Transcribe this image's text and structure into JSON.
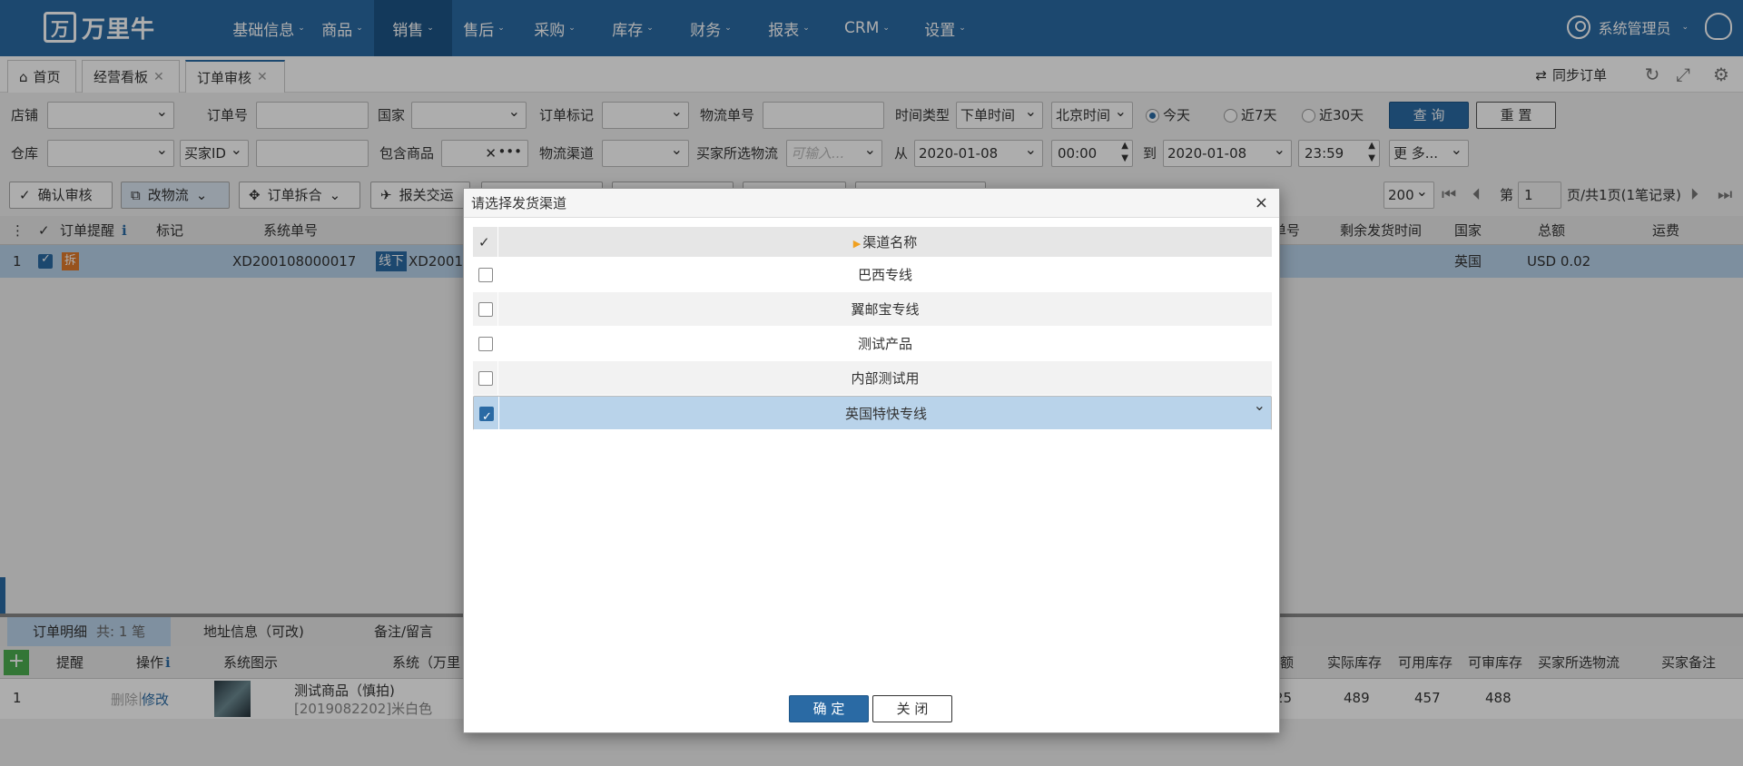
{
  "nav": {
    "logo_mark": "万",
    "logo_text": "万里牛",
    "menu": [
      "基础信息",
      "商品",
      "销售",
      "售后",
      "采购",
      "库存",
      "财务",
      "报表",
      "CRM",
      "设置"
    ],
    "active_index": 2,
    "user": "系统管理员"
  },
  "tabs": {
    "home": "首页",
    "t1": "经营看板",
    "t2": "订单审核",
    "sync": "同步订单"
  },
  "filters": {
    "shop": "店铺",
    "order_no": "订单号",
    "country": "国家",
    "order_mark": "订单标记",
    "logistics_no": "物流单号",
    "time_type": "时间类型",
    "time_type_val": "下单时间",
    "tz_val": "北京时间",
    "today": "今天",
    "d7": "近7天",
    "d30": "近30天",
    "query": "查 询",
    "reset": "重 置",
    "warehouse": "仓库",
    "buyer_id": "买家ID",
    "contains": "包含商品",
    "channel": "物流渠道",
    "buyer_logistics": "买家所选物流",
    "buyer_logistics_ph": "可输入...",
    "from": "从",
    "date_from": "2020-01-08",
    "time_from": "00:00",
    "to": "到",
    "date_to": "2020-01-08",
    "time_to": "23:59",
    "more": "更 多..."
  },
  "toolbar": {
    "confirm": "确认审核",
    "change": "改物流",
    "split": "订单拆合",
    "report": "报关交运",
    "page_size": "200",
    "page_label": "第",
    "page_num": "1",
    "page_info": "页/共1页(1笔记录)"
  },
  "grid": {
    "headers": {
      "remind": "订单提醒",
      "mark": "标记",
      "sys_no": "系统单号",
      "country": "国家",
      "total": "总额",
      "freight": "运费",
      "remaining": "剩余发货时间",
      "h_extra": "单号"
    },
    "row": {
      "idx": "1",
      "badge": "拆",
      "sys_no": "XD200108000017",
      "tag": "线下",
      "sys_no2": "XD2001",
      "country": "英国",
      "total": "USD 0.02"
    }
  },
  "lower": {
    "tabs": [
      "订单明细",
      "地址信息（可改)",
      "备注/留言"
    ],
    "count": "共: 1 笔",
    "headers": {
      "remind": "提醒",
      "op": "操作",
      "img": "系统图示",
      "sys": "系统（万里",
      "amt": "额",
      "real": "实际库存",
      "avail": "可用库存",
      "ok": "可审库存",
      "buyer_log": "买家所选物流",
      "buyer_note": "买家备注"
    },
    "row": {
      "idx": "1",
      "del": "删除",
      "edit": "修改",
      "name": "测试商品（慎拍)",
      "sku": "[2019082202]米白色",
      "amt": "25",
      "real": "489",
      "avail": "457",
      "ok": "488"
    }
  },
  "modal": {
    "title": "请选择发货渠道",
    "column": "渠道名称",
    "items": [
      {
        "label": "巴西专线",
        "checked": false
      },
      {
        "label": "翼邮宝专线",
        "checked": false
      },
      {
        "label": "测试产品",
        "checked": false
      },
      {
        "label": "内部测试用",
        "checked": false
      },
      {
        "label": "英国特快专线",
        "checked": true
      }
    ],
    "ok": "确 定",
    "close": "关 闭"
  }
}
